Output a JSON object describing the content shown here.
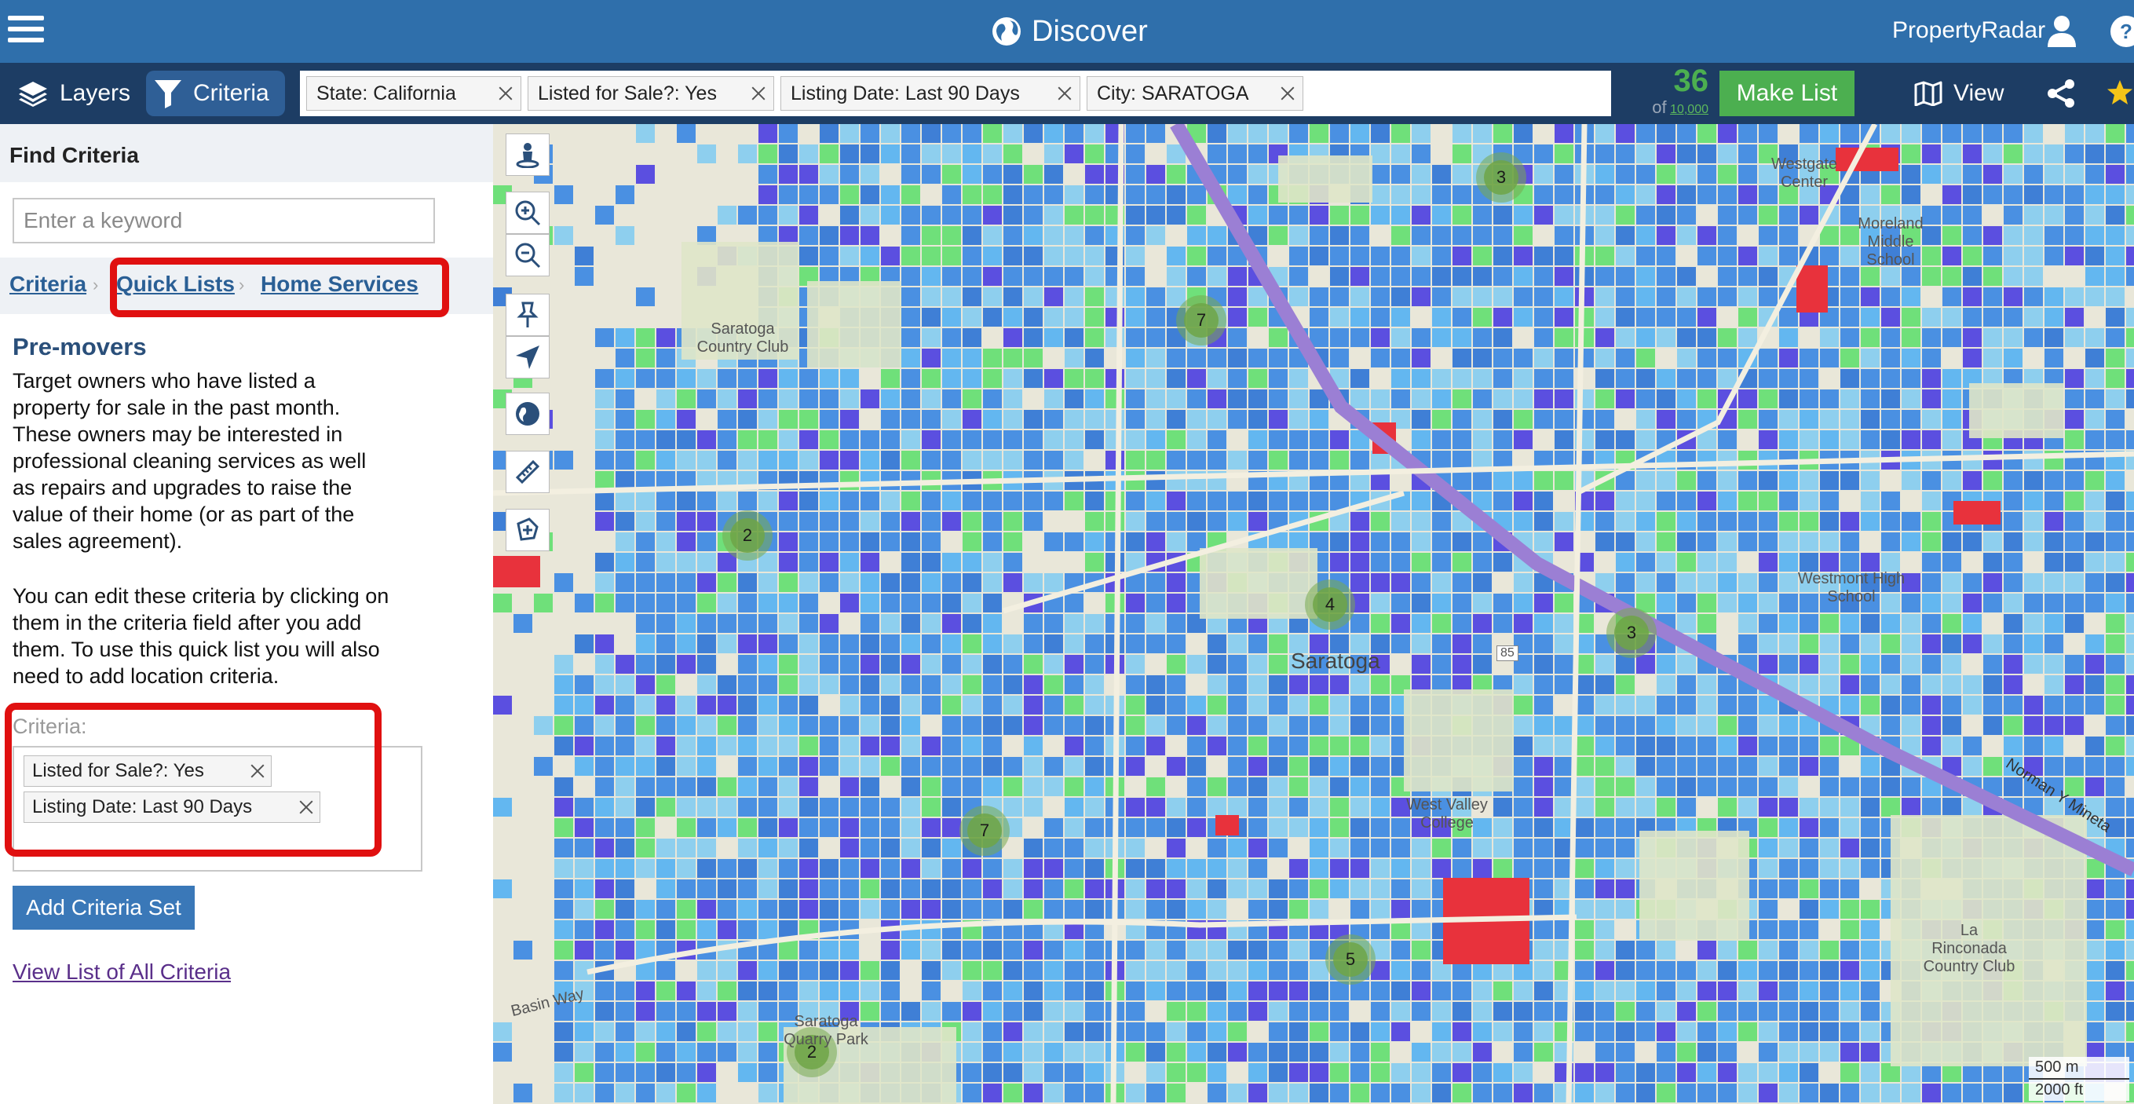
{
  "header": {
    "title": "Discover",
    "brand": "PropertyRadar"
  },
  "toolbar": {
    "layers_label": "Layers",
    "criteria_label": "Criteria",
    "chips": [
      {
        "label": "State: California"
      },
      {
        "label": "Listed for Sale?: Yes"
      },
      {
        "label": "Listing Date: Last 90 Days"
      },
      {
        "label": "City: SARATOGA"
      }
    ],
    "count": "36",
    "count_of": "of",
    "count_total": "10,000",
    "make_list_label": "Make List",
    "view_label": "View"
  },
  "panel": {
    "header": "Find Criteria",
    "keyword_placeholder": "Enter a keyword",
    "breadcrumbs": [
      "Criteria",
      "Quick Lists",
      "Home Services"
    ],
    "section_title": "Pre-movers",
    "description_1": "Target owners who have listed a property for sale in the past month. These owners may be interested in professional cleaning services as well as repairs and upgrades to raise the value of their home (or as part of the sales agreement).",
    "description_2": "You can edit these criteria by clicking on them in the criteria field after you add them. To use this quick list you will also need to add location criteria.",
    "criteria_label": "Criteria:",
    "criteria_chips": [
      "Listed for Sale?: Yes",
      "Listing Date: Last 90 Days"
    ],
    "add_button": "Add Criteria Set",
    "view_all_link": "View List of All Criteria"
  },
  "map": {
    "clusters": [
      "3",
      "7",
      "2",
      "4",
      "3",
      "7",
      "5",
      "2"
    ],
    "labels": {
      "country_club": "Saratoga Country Club",
      "west_valley": "West Valley College",
      "westmont": "Westmont High School",
      "saratoga": "Saratoga",
      "quarry_park": "Saratoga Quarry Park",
      "westgate": "Westgate Center",
      "moreland": "Moreland Middle School",
      "la_rinconada": "La Rinconada Country Club",
      "basin_way": "Basin Way",
      "norman_y_mineta": "Norman Y Mineta",
      "highway": "85"
    },
    "scale_metric": "500 m",
    "scale_imperial": "2000 ft"
  },
  "colors": {
    "header_bg": "#2f6fab",
    "toolbar_bg": "#1d3d64",
    "count_green": "#4caf50",
    "highlight_red": "#e01010",
    "parcel_blue": "#4a90e2",
    "parcel_light": "#8ecfee",
    "parcel_purple": "#5b4fe0",
    "parcel_green": "#6fe07a"
  },
  "icons": {
    "menu": "hamburger-icon",
    "globe": "globe-icon",
    "user": "user-icon",
    "help": "help-icon",
    "layers": "layers-icon",
    "filter": "filter-icon",
    "map_view": "map-icon",
    "share": "share-icon",
    "star": "star-icon"
  }
}
